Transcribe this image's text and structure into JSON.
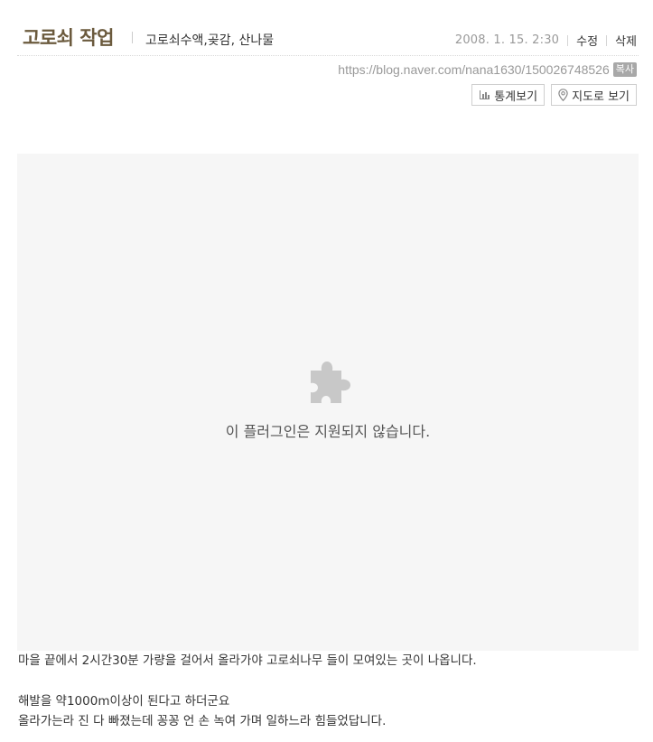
{
  "post": {
    "title": "고로쇠 작업",
    "category": "고로쇠수액,곶감, 산나물",
    "date": "2008. 1. 15. 2:30",
    "edit_label": "수정",
    "delete_label": "삭제",
    "url": "https://blog.naver.com/nana1630/150026748526",
    "copy_label": "복사",
    "stats_button": "통계보기",
    "map_button": "지도로 보기"
  },
  "plugin": {
    "message": "이 플러그인은 지원되지 않습니다.",
    "icon": "puzzle-icon"
  },
  "body": {
    "paragraph1": "마을 끝에서 2시간30분 가량을 걸어서 올라가야 고로쇠나무 들이 모여있는 곳이 나옵니다.",
    "paragraph2": "해발을 약1000m이상이 된다고 하더군요",
    "paragraph3": "올라가는라 진 다 빠졌는데 꽁꽁 언 손 녹여 가며 일하느라 힘들었답니다."
  },
  "colors": {
    "title": "#6b5a3d",
    "plugin_bg": "#f6f6f6",
    "muted": "#999999"
  }
}
